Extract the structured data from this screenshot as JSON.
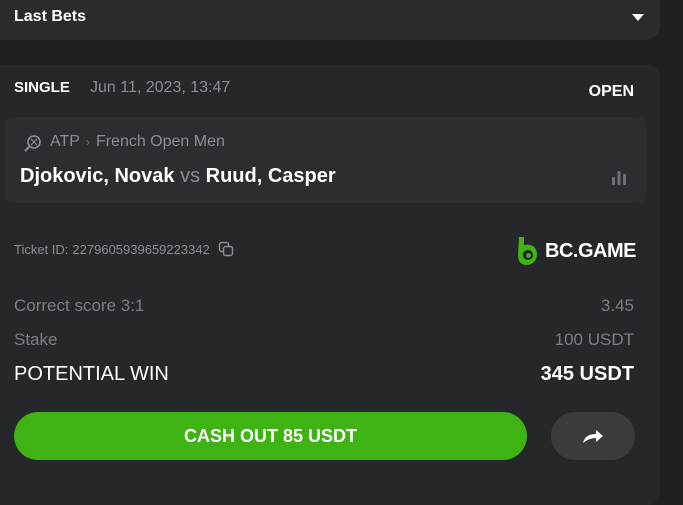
{
  "dropdown": {
    "label": "Last Bets"
  },
  "bet": {
    "type": "SINGLE",
    "date": "Jun 11, 2023, 13:47",
    "status": "OPEN",
    "event": {
      "league": "ATP",
      "separator": "›",
      "tournament": "French Open Men",
      "home": "Djokovic, Novak",
      "vs": "vs",
      "away": "Ruud, Casper",
      "sport_icon": "tennis-icon",
      "stats_icon": "stats-icon"
    },
    "ticket_label": "Ticket ID:",
    "ticket_id": "2279605939659223342",
    "brand": "BC.GAME",
    "selection": {
      "label": "Correct score 3:1",
      "odds": "3.45"
    },
    "stake": {
      "label": "Stake",
      "value": "100 USDT"
    },
    "potential_win": {
      "label": "POTENTIAL WIN",
      "value": "345 USDT"
    },
    "cashout_label": "CASH OUT 85 USDT",
    "share_icon": "share-icon"
  },
  "colors": {
    "background": "#1f2022",
    "card": "#26272a",
    "accent_green": "#3fb313",
    "muted_text": "#8c8e93"
  }
}
